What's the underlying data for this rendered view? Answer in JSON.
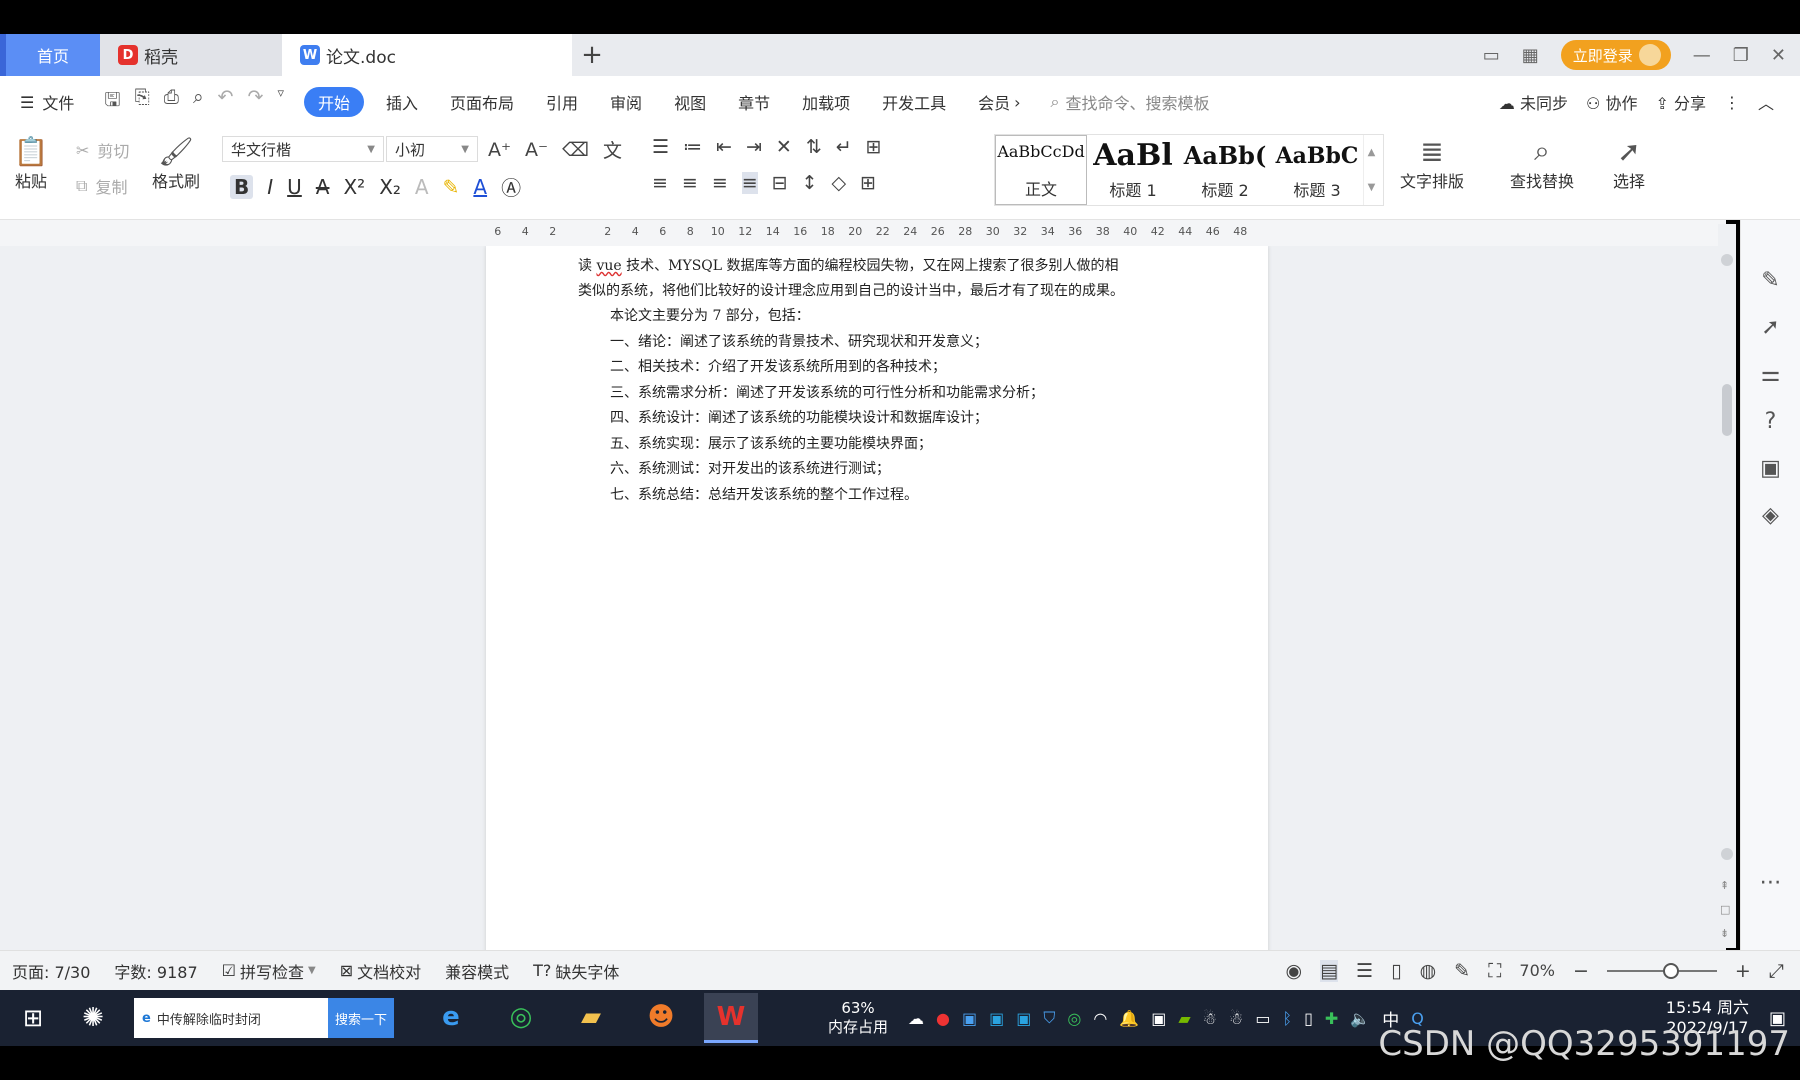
{
  "tabs": {
    "home": "首页",
    "docer": "稻壳",
    "doc": "论文.doc",
    "new_tab": "+",
    "login": "立即登录"
  },
  "menu": {
    "file": "文件",
    "tabs": [
      "开始",
      "插入",
      "页面布局",
      "引用",
      "审阅",
      "视图",
      "章节",
      "加载项",
      "开发工具",
      "会员"
    ],
    "more": "›",
    "search_placeholder": "查找命令、搜索模板",
    "sync": "未同步",
    "collab": "协作",
    "share": "分享"
  },
  "ribbon": {
    "paste": "粘贴",
    "cut": "剪切",
    "copy": "复制",
    "format_painter": "格式刷",
    "font_name": "华文行楷",
    "font_size": "小初",
    "styles": [
      {
        "sample": "AaBbCcDd",
        "label": "正文"
      },
      {
        "sample": "AaBl",
        "label": "标题 1"
      },
      {
        "sample": "AaBb(",
        "label": "标题 2"
      },
      {
        "sample": "AaBbC",
        "label": "标题 3"
      }
    ],
    "text_layout": "文字排版",
    "find_replace": "查找替换",
    "select": "选择"
  },
  "ruler": {
    "numbers": [
      "6",
      "4",
      "2",
      "",
      "2",
      "4",
      "6",
      "8",
      "10",
      "12",
      "14",
      "16",
      "18",
      "20",
      "22",
      "24",
      "26",
      "28",
      "30",
      "32",
      "34",
      "36",
      "38",
      "40",
      "42",
      "44",
      "46",
      "48"
    ]
  },
  "document": {
    "line1_pre": "读 ",
    "line1_u": "vue",
    "line1_post": " 技术、MYSQL 数据库等方面的编程校园失物，又在网上搜索了很多别人做的相",
    "line2": "类似的系统，将他们比较好的设计理念应用到自己的设计当中，最后才有了现在的成果。",
    "intro": "本论文主要分为 7 部分，包括：",
    "items": [
      "一、绪论：阐述了该系统的背景技术、研究现状和开发意义；",
      "二、相关技术：介绍了开发该系统所用到的各种技术；",
      "三、系统需求分析：阐述了开发该系统的可行性分析和功能需求分析；",
      "四、系统设计：阐述了该系统的功能模块设计和数据库设计；",
      "五、系统实现：展示了该系统的主要功能模块界面；",
      "六、系统测试：对开发出的该系统进行测试；",
      "七、系统总结：总结开发该系统的整个工作过程。"
    ]
  },
  "status": {
    "page": "页面: 7/30",
    "words": "字数: 9187",
    "spell": "拼写检查",
    "proof": "文档校对",
    "compat": "兼容模式",
    "missing_font": "缺失字体",
    "zoom": "70%"
  },
  "taskbar": {
    "search_text": "中传解除临时封闭",
    "search_button": "搜索一下",
    "mem_pct": "63%",
    "mem_label": "内存占用",
    "ime": "中",
    "time": "15:54 周六",
    "date": "2022/9/17"
  },
  "watermark": "CSDN @QQ3295391197"
}
